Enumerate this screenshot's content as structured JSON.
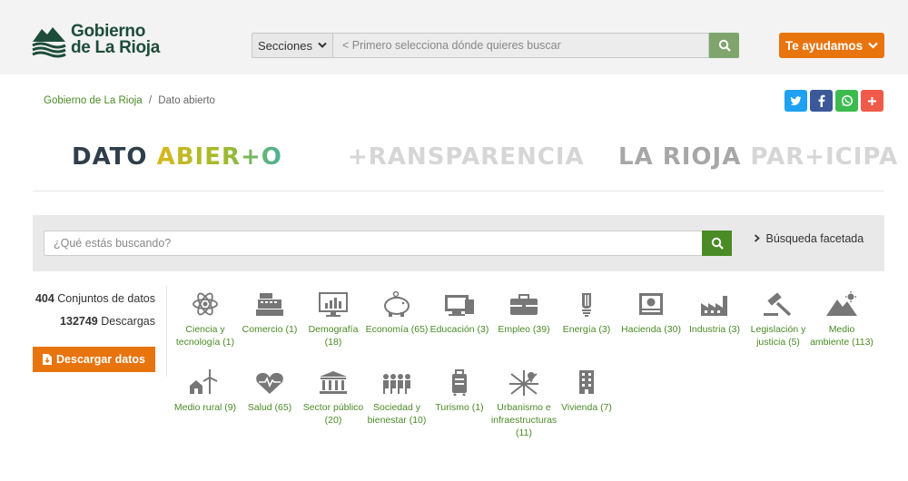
{
  "header": {
    "logo_line1": "Gobierno",
    "logo_line2": "de La Rioja",
    "sections_label": "Secciones",
    "search_placeholder": "< Primero selecciona dónde quieres buscar",
    "help_label": "Te ayudamos"
  },
  "breadcrumb": {
    "home": "Gobierno de La Rioja",
    "sep": "/",
    "current": "Dato abierto"
  },
  "social": [
    {
      "name": "twitter",
      "color": "#1da1f2"
    },
    {
      "name": "facebook",
      "color": "#3b5998"
    },
    {
      "name": "whatsapp",
      "color": "#3dbb4f"
    },
    {
      "name": "share",
      "color": "#f05a48"
    }
  ],
  "brands": {
    "dato": "DATO",
    "abierto": "ABIER+O",
    "transparencia": "+RANSPARENCIA",
    "participa_a": "LA RIOJA",
    "participa_b": "PAR+ICIPA"
  },
  "search": {
    "placeholder": "¿Qué estás buscando?",
    "facet_label": "Búsqueda facetada"
  },
  "stats": {
    "datasets_count": "404",
    "datasets_label": "Conjuntos de datos",
    "downloads_count": "132749",
    "downloads_label": "Descargas",
    "download_button": "Descargar datos"
  },
  "categories": [
    {
      "label": "Ciencia y tecnología (1)",
      "icon": "atom-icon"
    },
    {
      "label": "Comercio (1)",
      "icon": "cash-register-icon"
    },
    {
      "label": "Demografía (18)",
      "icon": "monitor-chart-icon"
    },
    {
      "label": "Economía (65)",
      "icon": "piggy-bank-icon"
    },
    {
      "label": "Educación (3)",
      "icon": "book-screen-icon"
    },
    {
      "label": "Empleo (39)",
      "icon": "briefcase-icon"
    },
    {
      "label": "Energía (3)",
      "icon": "bulb-icon"
    },
    {
      "label": "Hacienda (30)",
      "icon": "banknote-icon"
    },
    {
      "label": "Industria (3)",
      "icon": "factory-icon"
    },
    {
      "label": "Legislación y justicia (5)",
      "icon": "gavel-icon"
    },
    {
      "label": "Medio ambiente (113)",
      "icon": "mountain-sun-icon"
    },
    {
      "label": "Medio rural (9)",
      "icon": "windmill-house-icon"
    },
    {
      "label": "Salud (65)",
      "icon": "heart-pulse-icon"
    },
    {
      "label": "Sector público (20)",
      "icon": "government-building-icon"
    },
    {
      "label": "Sociedad y bienestar (10)",
      "icon": "people-icon"
    },
    {
      "label": "Turismo (1)",
      "icon": "suitcase-icon"
    },
    {
      "label": "Urbanismo e infraestructuras (11)",
      "icon": "city-map-icon"
    },
    {
      "label": "Vivienda (7)",
      "icon": "apartment-building-icon"
    }
  ]
}
